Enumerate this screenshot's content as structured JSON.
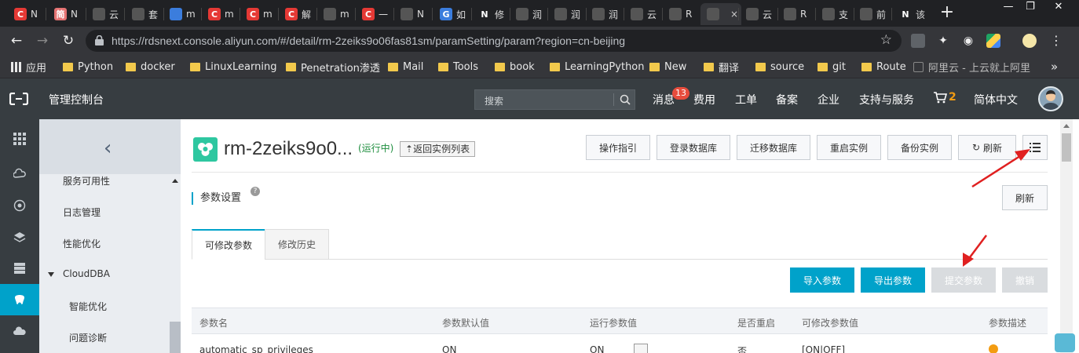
{
  "browser": {
    "tabs": [
      {
        "letters": "C",
        "title": "N",
        "color": "#e53935"
      },
      {
        "letters": "简",
        "title": "N",
        "color": "#e57373"
      },
      {
        "letters": "",
        "title": "云",
        "color": "#555"
      },
      {
        "letters": "",
        "title": "套",
        "color": "#555"
      },
      {
        "letters": "",
        "title": "m",
        "color": "#3b7ddd"
      },
      {
        "letters": "C",
        "title": "m",
        "color": "#e53935"
      },
      {
        "letters": "C",
        "title": "m",
        "color": "#e53935"
      },
      {
        "letters": "C",
        "title": "解",
        "color": "#e53935"
      },
      {
        "letters": "",
        "title": "m",
        "color": "#555"
      },
      {
        "letters": "C",
        "title": "一",
        "color": "#e53935"
      },
      {
        "letters": "",
        "title": "N",
        "color": "#555"
      },
      {
        "letters": "G",
        "title": "如",
        "color": "#3b7ddd"
      },
      {
        "letters": "N",
        "title": "修",
        "color": "#202124"
      },
      {
        "letters": "",
        "title": "润",
        "color": "#555"
      },
      {
        "letters": "",
        "title": "润",
        "color": "#555"
      },
      {
        "letters": "",
        "title": "润",
        "color": "#555"
      },
      {
        "letters": "",
        "title": "云",
        "color": "#555"
      },
      {
        "letters": "",
        "title": "R",
        "color": "#555"
      },
      {
        "letters": "",
        "title": "",
        "color": "#555",
        "active": true
      },
      {
        "letters": "",
        "title": "云",
        "color": "#555"
      },
      {
        "letters": "",
        "title": "R",
        "color": "#555"
      },
      {
        "letters": "",
        "title": "支",
        "color": "#555"
      },
      {
        "letters": "",
        "title": "前",
        "color": "#555"
      },
      {
        "letters": "N",
        "title": "该",
        "color": "#202124"
      }
    ],
    "active_tab_close": "×",
    "new_tab": "+",
    "window_controls": [
      "—",
      "❐",
      "✕"
    ],
    "url": "https://rdsnext.console.aliyun.com/#/detail/rm-2zeiks9o06fas81sm/paramSetting/param?region=cn-beijing",
    "bookmarks": [
      {
        "label": "应用",
        "kind": "apps"
      },
      {
        "label": "Python",
        "kind": "folder"
      },
      {
        "label": "docker",
        "kind": "folder"
      },
      {
        "label": "LinuxLearning",
        "kind": "folder"
      },
      {
        "label": "Penetration渗透",
        "kind": "folder"
      },
      {
        "label": "Mail",
        "kind": "folder"
      },
      {
        "label": "Tools",
        "kind": "folder"
      },
      {
        "label": "book",
        "kind": "folder"
      },
      {
        "label": "LearningPython",
        "kind": "folder"
      },
      {
        "label": "New",
        "kind": "folder"
      },
      {
        "label": "翻译",
        "kind": "folder"
      },
      {
        "label": "source",
        "kind": "folder"
      },
      {
        "label": "git",
        "kind": "folder"
      },
      {
        "label": "Route",
        "kind": "folder"
      },
      {
        "label": "阿里云 - 上云就上阿里",
        "kind": "page"
      }
    ],
    "bookmarks_more": "»"
  },
  "console": {
    "title": "管理控制台",
    "search_placeholder": "搜索",
    "nav": {
      "messages": "消息",
      "message_count": "13",
      "billing": "费用",
      "tickets": "工单",
      "icp": "备案",
      "enterprise": "企业",
      "support": "支持与服务",
      "cart_count": "2",
      "language": "简体中文"
    }
  },
  "sidebar": {
    "items": [
      {
        "label": "服务可用性"
      },
      {
        "label": "日志管理"
      },
      {
        "label": "性能优化"
      },
      {
        "label": "CloudDBA"
      },
      {
        "label": "智能优化"
      },
      {
        "label": "问题诊断"
      }
    ]
  },
  "instance": {
    "title": "rm-2zeiks9o0...",
    "status": "(运行中)",
    "back_label": "返回实例列表",
    "actions": [
      "操作指引",
      "登录数据库",
      "迁移数据库",
      "重启实例",
      "备份实例",
      "刷新"
    ]
  },
  "param": {
    "section_title": "参数设置",
    "help": "?",
    "refresh": "刷新",
    "tabs": [
      "可修改参数",
      "修改历史"
    ],
    "buttons": {
      "import": "导入参数",
      "export": "导出参数",
      "submit": "提交参数",
      "cancel": "撤销"
    },
    "columns": [
      "参数名",
      "参数默认值",
      "运行参数值",
      "是否重启",
      "可修改参数值",
      "参数描述"
    ],
    "rows": [
      {
        "name": "automatic_sp_privileges",
        "default": "ON",
        "running": "ON",
        "restart": "否",
        "allowed": "[ON|OFF]"
      }
    ]
  }
}
